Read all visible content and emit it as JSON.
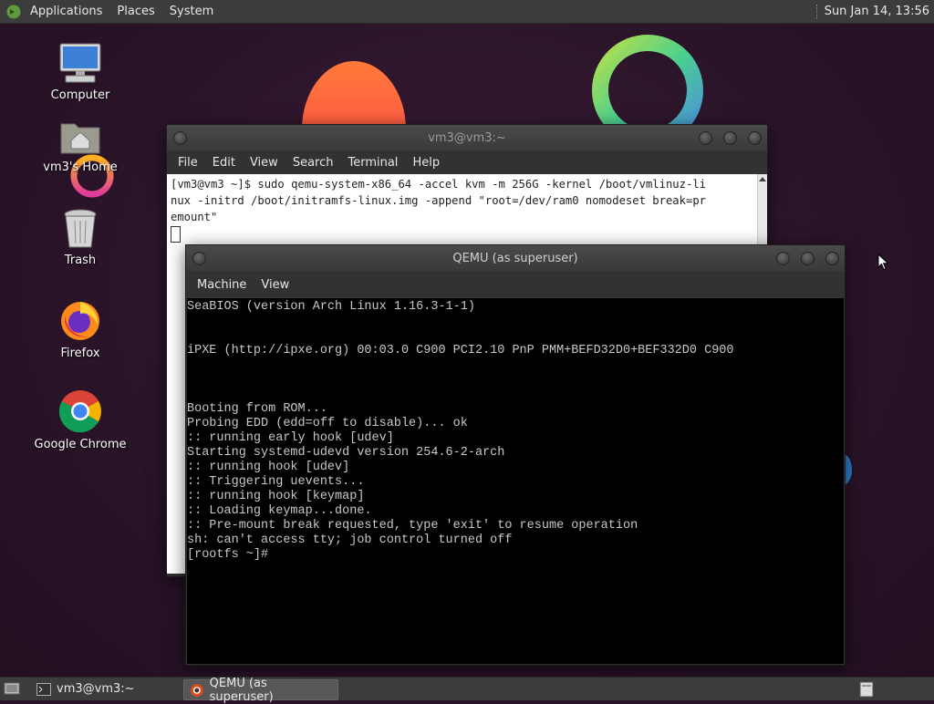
{
  "top_panel": {
    "menus": [
      "Applications",
      "Places",
      "System"
    ],
    "clock": "Sun Jan 14, 13:56"
  },
  "desktop_icons": [
    {
      "label": "Computer",
      "icon": "computer-icon"
    },
    {
      "label": "vm3's Home",
      "icon": "home-folder-icon"
    },
    {
      "label": "Trash",
      "icon": "trash-icon"
    },
    {
      "label": "Firefox",
      "icon": "firefox-icon"
    },
    {
      "label": "Google Chrome",
      "icon": "chrome-icon"
    }
  ],
  "terminal": {
    "title": "vm3@vm3:~",
    "menus": [
      "File",
      "Edit",
      "View",
      "Search",
      "Terminal",
      "Help"
    ],
    "lines": [
      "[vm3@vm3 ~]$ sudo qemu-system-x86_64 -accel kvm -m 256G -kernel /boot/vmlinuz-li",
      "nux -initrd /boot/initramfs-linux.img -append \"root=/dev/ram0 nomodeset break=pr",
      "emount\""
    ]
  },
  "qemu": {
    "title": "QEMU (as superuser)",
    "menus": [
      "Machine",
      "View"
    ],
    "screen_lines": [
      "SeaBIOS (version Arch Linux 1.16.3-1-1)",
      "",
      "",
      "iPXE (http://ipxe.org) 00:03.0 C900 PCI2.10 PnP PMM+BEFD32D0+BEF332D0 C900",
      "",
      "",
      "",
      "Booting from ROM...",
      "Probing EDD (edd=off to disable)... ok",
      ":: running early hook [udev]",
      "Starting systemd-udevd version 254.6-2-arch",
      ":: running hook [udev]",
      ":: Triggering uevents...",
      ":: running hook [keymap]",
      ":: Loading keymap...done.",
      ":: Pre-mount break requested, type 'exit' to resume operation",
      "sh: can't access tty; job control turned off",
      "[rootfs ~]#"
    ]
  },
  "taskbar": {
    "items": [
      {
        "label": "vm3@vm3:~",
        "icon": "terminal-icon",
        "active": false
      },
      {
        "label": "QEMU (as superuser)",
        "icon": "qemu-icon",
        "active": true
      }
    ]
  }
}
